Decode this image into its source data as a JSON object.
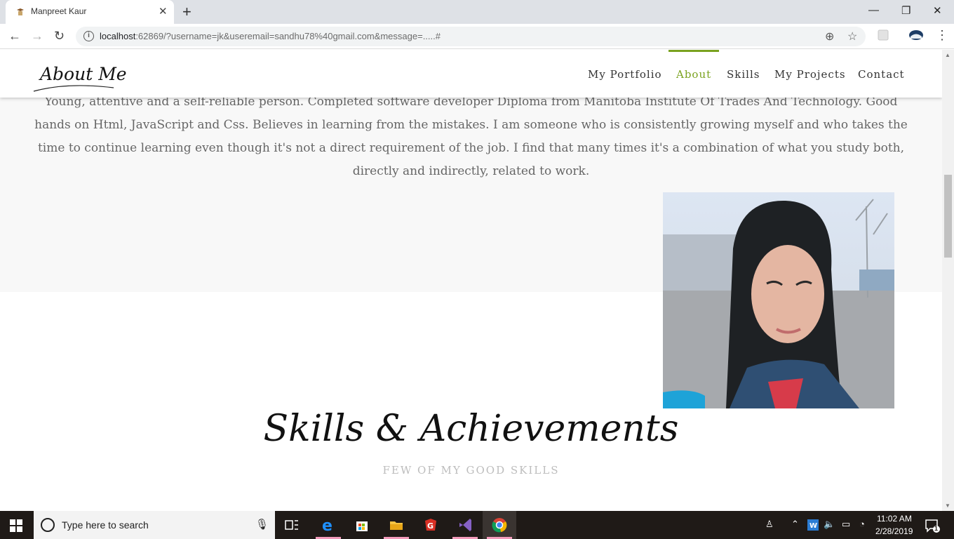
{
  "browser": {
    "tab_title": "Manpreet Kaur",
    "url_host": "localhost",
    "url_rest": ":62869/?username=jk&useremail=sandhu78%40gmail.com&message=.....#",
    "window_controls": [
      "minimize",
      "maximize",
      "close"
    ]
  },
  "header": {
    "logo": "About Me",
    "nav": [
      {
        "label": "My Portfolio"
      },
      {
        "label": "About"
      },
      {
        "label": "Skills"
      },
      {
        "label": "My Projects"
      },
      {
        "label": "Contact"
      }
    ],
    "active_item": "About",
    "accent_color": "#7aa21f"
  },
  "about": {
    "text": "Young, attentive and a self-reliable person. Completed software developer Diploma from Manitoba Institute Of Trades And Technology. Good hands on Html, JavaScript and Css. Believes in learning from the mistakes. I am someone who is consistently growing myself and who takes the time to continue learning even though it's not a direct requirement of the job. I find that many times it's a combination of what you study both, directly and indirectly, related to work."
  },
  "skills": {
    "title": "Skills & Achievements",
    "subtitle": "FEW OF MY GOOD SKILLS"
  },
  "taskbar": {
    "search_placeholder": "Type here to search",
    "time": "11:02 AM",
    "date": "2/28/2019",
    "notification_count": "1"
  }
}
